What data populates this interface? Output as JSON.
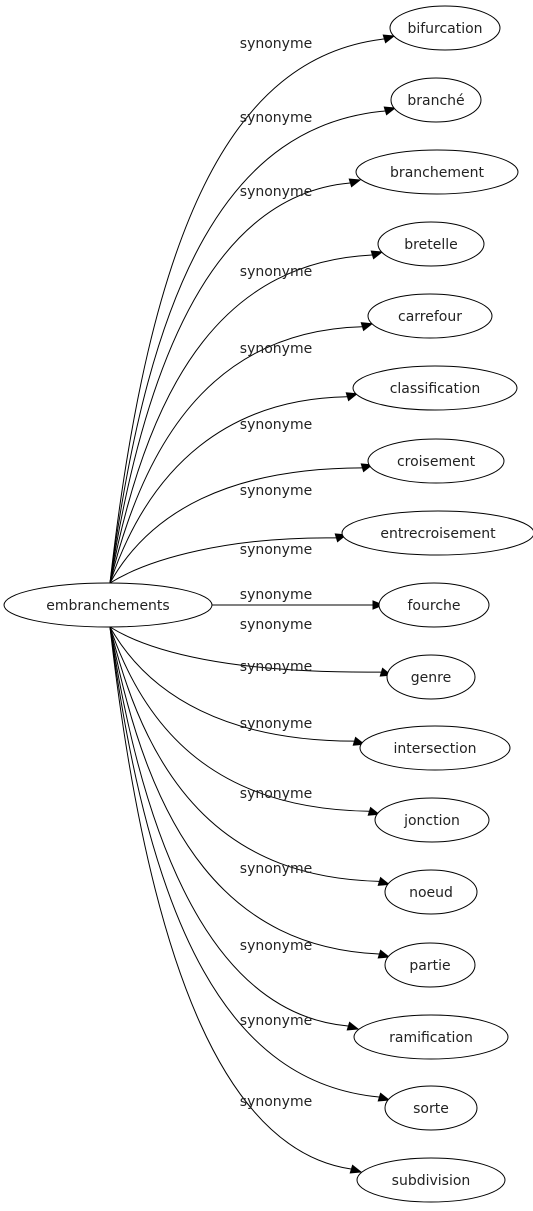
{
  "graph": {
    "root": "embranchements",
    "edge_label": "synonyme",
    "nodes": [
      "bifurcation",
      "branché",
      "branchement",
      "bretelle",
      "carrefour",
      "classification",
      "croisement",
      "entrecroisement",
      "fourche",
      "genre",
      "intersection",
      "jonction",
      "noeud",
      "partie",
      "ramification",
      "sorte",
      "subdivision"
    ]
  }
}
